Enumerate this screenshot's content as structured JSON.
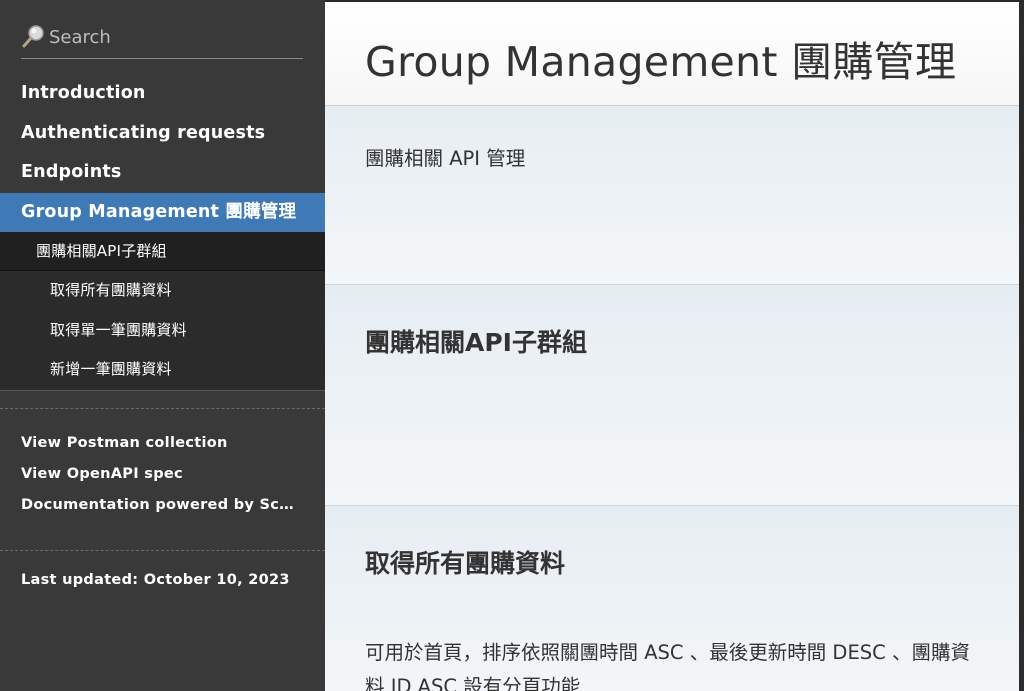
{
  "sidebar": {
    "search_placeholder": "Search",
    "toc": [
      {
        "label": "Introduction"
      },
      {
        "label": "Authenticating requests"
      },
      {
        "label": "Endpoints"
      },
      {
        "label": "Group Management 團購管理"
      }
    ],
    "subgroup": "團購相關API子群組",
    "subitems": [
      "取得所有團購資料",
      "取得單一筆團購資料",
      "新增一筆團購資料"
    ],
    "links": [
      "View Postman collection",
      "View OpenAPI spec",
      "Documentation powered by Scribe ✍"
    ],
    "last_updated": "Last updated: October 10, 2023"
  },
  "main": {
    "title": "Group Management 團購管理",
    "intro": "團購相關 API 管理",
    "subgroup_heading": "團購相關API子群組",
    "endpoint_heading": "取得所有團購資料",
    "endpoint_desc": "可用於首頁，排序依照關團時間 ASC 、最後更新時間 DESC 、團購資料 ID ASC 設有分頁功能"
  },
  "colors": {
    "sidebar_bg": "#393939",
    "active_bg": "#3f7ab7",
    "content_bg": "#eaf0f4",
    "text": "#333333"
  }
}
